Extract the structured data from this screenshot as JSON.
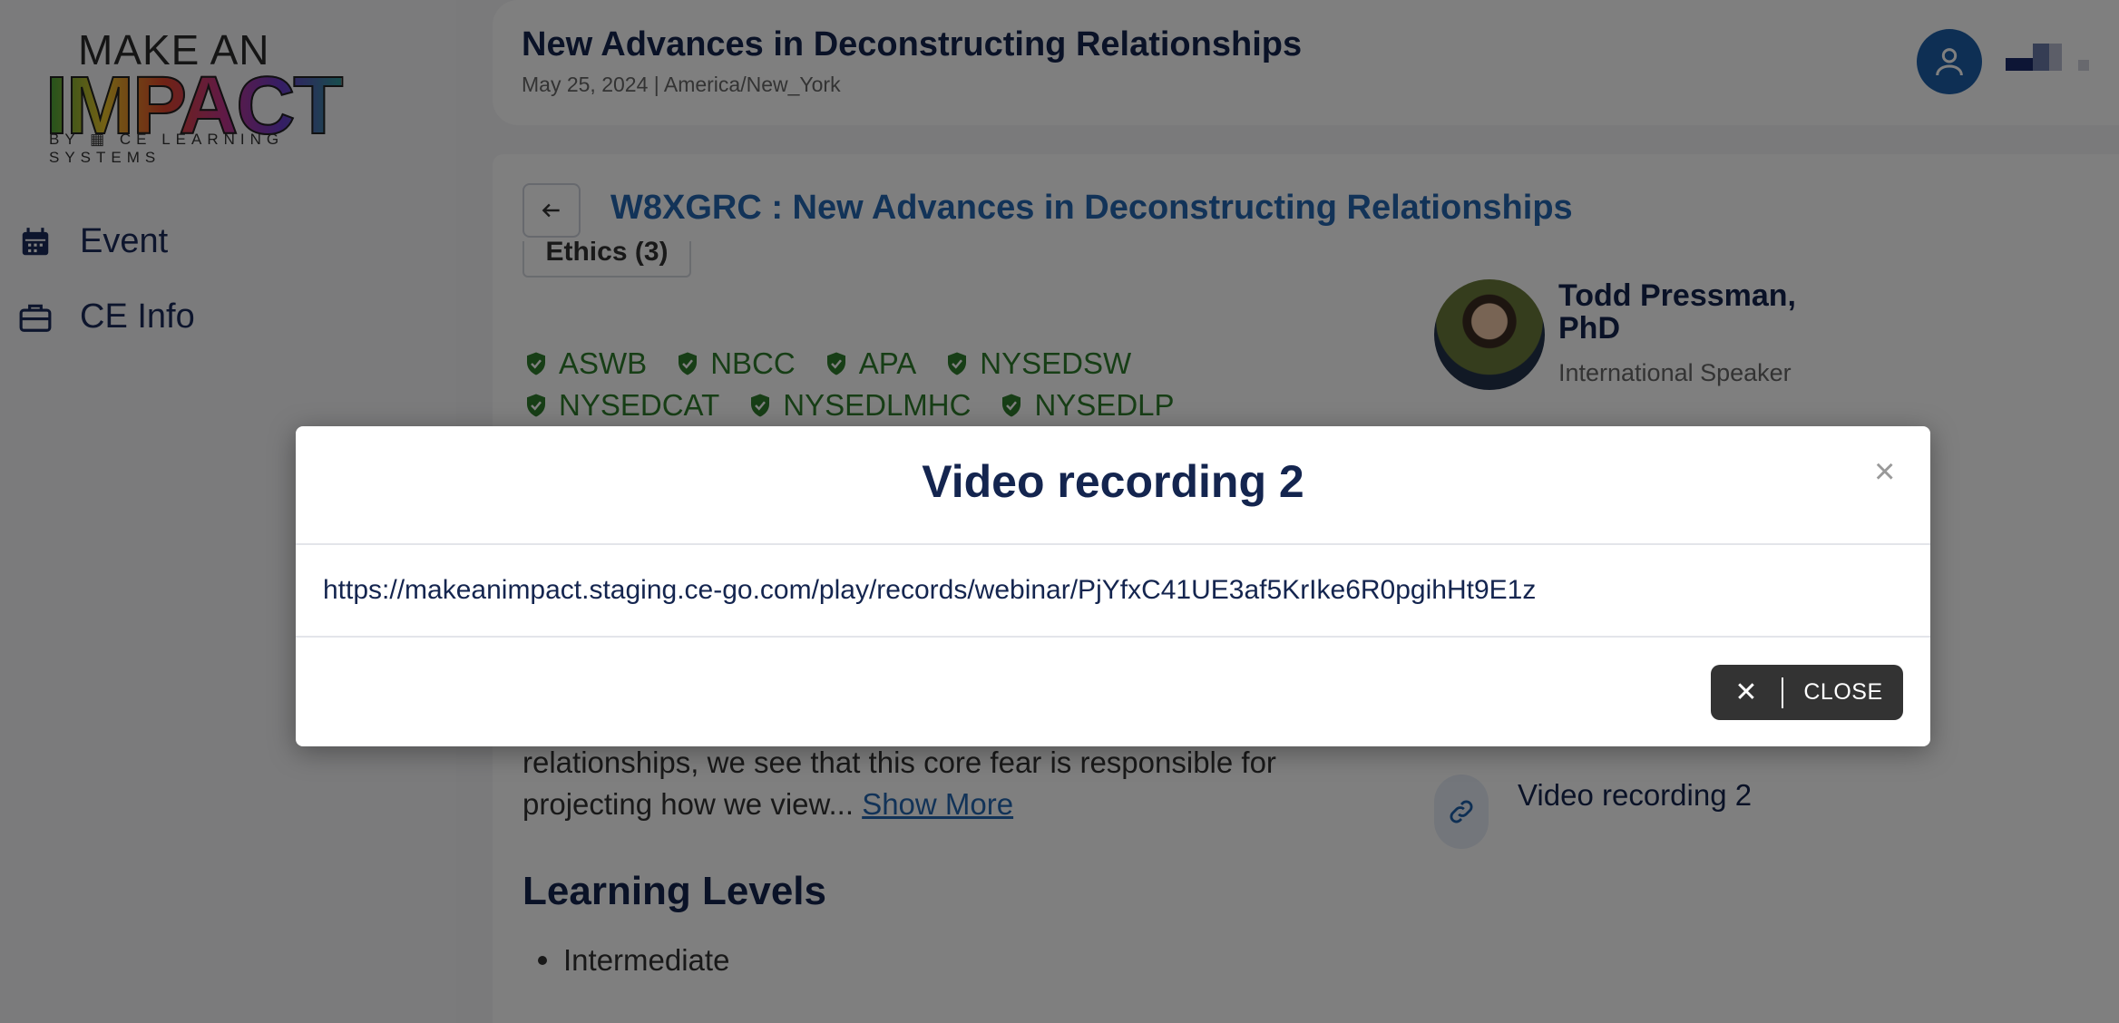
{
  "logo": {
    "line1": "MAKE AN",
    "line2": "IMPACT",
    "line3": "BY ▦ CE LEARNING SYSTEMS"
  },
  "sidebar": {
    "items": [
      {
        "label": "Event",
        "icon": "calendar-icon"
      },
      {
        "label": "CE Info",
        "icon": "briefcase-icon"
      }
    ]
  },
  "header": {
    "title": "New Advances in Deconstructing Relationships",
    "subtitle": "May 25, 2024 | America/New_York"
  },
  "main": {
    "code_title": "W8XGRC : New Advances in Deconstructing Relationships",
    "ethics_chip": "Ethics (3)",
    "accreditations_row1": [
      "ASWB",
      "NBCC",
      "APA",
      "NYSEDSW"
    ],
    "accreditations_row2": [
      "NYSEDCAT",
      "NYSEDLMHC",
      "NYSEDLP"
    ],
    "speaker": {
      "name": "Todd Pressman, PhD",
      "role": "International Speaker"
    },
    "description": "relationships, we see that this core fear is responsible for projecting how we view...",
    "show_more": "Show More",
    "learning_levels_title": "Learning Levels",
    "learning_levels": [
      "Intermediate"
    ],
    "recording_label": "Video recording 2"
  },
  "modal": {
    "title": "Video recording 2",
    "close_x": "×",
    "url": "https://makeanimpact.staging.ce-go.com/play/records/webinar/PjYfxC41UE3af5KrIke6R0pgihHt9E1z",
    "close_icon": "✕",
    "close_label": "CLOSE"
  }
}
